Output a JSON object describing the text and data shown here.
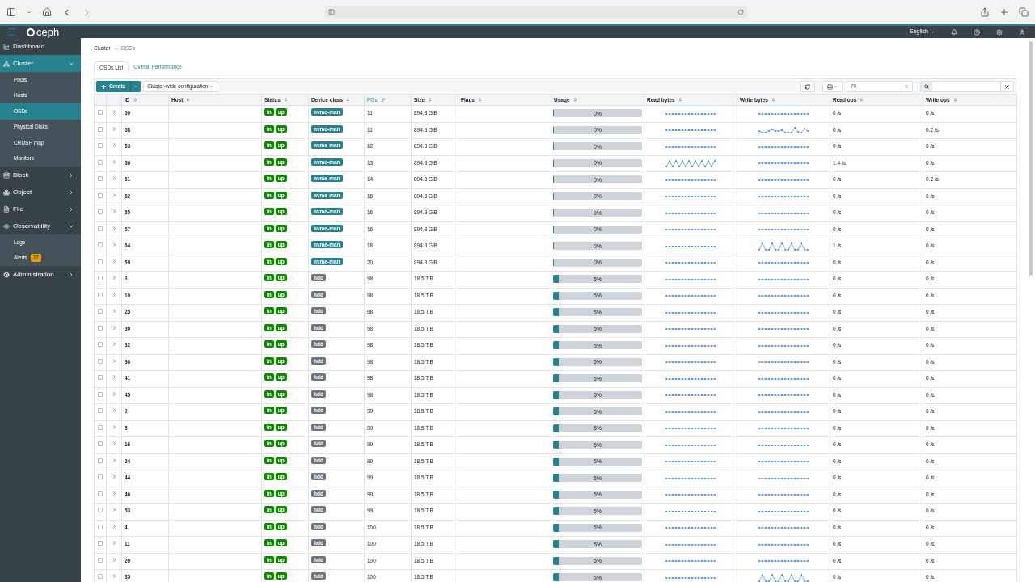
{
  "navbar": {
    "brand": "ceph",
    "language": "English"
  },
  "sidebar": [
    {
      "label": "Dashboard",
      "selected": false
    },
    {
      "label": "Cluster",
      "selected": true,
      "expanded": true,
      "children": [
        {
          "label": "Pools",
          "selected": false
        },
        {
          "label": "Hosts",
          "selected": false
        },
        {
          "label": "OSDs",
          "selected": true
        },
        {
          "label": "Physical Disks",
          "selected": false
        },
        {
          "label": "CRUSH map",
          "selected": false
        },
        {
          "label": "Monitors",
          "selected": false
        }
      ]
    },
    {
      "label": "Block",
      "selected": false,
      "expanded": false
    },
    {
      "label": "Object",
      "selected": false,
      "expanded": false
    },
    {
      "label": "File",
      "selected": false,
      "expanded": false
    },
    {
      "label": "Observability",
      "selected": false,
      "expanded": true,
      "children": [
        {
          "label": "Logs",
          "selected": false
        },
        {
          "label": "Alerts",
          "selected": false,
          "badge": "27"
        }
      ]
    },
    {
      "label": "Administration",
      "selected": false,
      "expanded": false
    }
  ],
  "breadcrumb": [
    "Cluster",
    "OSDs"
  ],
  "tabs": [
    {
      "label": "OSDs List",
      "selected": true
    },
    {
      "label": "Overall Performance",
      "selected": false
    }
  ],
  "toolbar": {
    "create": "Create",
    "config": "Cluster-wide configuration",
    "page_size": "70"
  },
  "table": {
    "columns": [
      {
        "label": "ID",
        "sorted": false
      },
      {
        "label": "Host",
        "sorted": false
      },
      {
        "label": "Status",
        "sorted": false
      },
      {
        "label": "Device class",
        "sorted": false
      },
      {
        "label": "PGs",
        "sorted": true
      },
      {
        "label": "Size",
        "sorted": false
      },
      {
        "label": "Flags",
        "sorted": false
      },
      {
        "label": "Usage",
        "sorted": false
      },
      {
        "label": "Read bytes",
        "sorted": false
      },
      {
        "label": "Write bytes",
        "sorted": false
      },
      {
        "label": "Read ops",
        "sorted": false
      },
      {
        "label": "Write ops",
        "sorted": false
      }
    ],
    "rows": [
      {
        "id": "60",
        "status": [
          "in",
          "up"
        ],
        "device_class": "nvme-man",
        "kind": "nvme",
        "pgs": "11",
        "size": "894.3 GiB",
        "usage": "0%",
        "level": 0,
        "read_bytes": {
          "kind": "flat"
        },
        "write_bytes": {
          "kind": "flat"
        },
        "read_ops": "0 /s",
        "write_ops": "0 /s",
        "checked": false
      },
      {
        "id": "68",
        "status": [
          "in",
          "up"
        ],
        "device_class": "nvme-man",
        "kind": "nvme",
        "pgs": "11",
        "size": "894.3 GiB",
        "usage": "0%",
        "level": 0,
        "read_bytes": {
          "kind": "flat"
        },
        "write_bytes": {
          "kind": "wavy"
        },
        "read_ops": "0 /s",
        "write_ops": "0.2 /s",
        "checked": false
      },
      {
        "id": "63",
        "status": [
          "in",
          "up"
        ],
        "device_class": "nvme-man",
        "kind": "nvme",
        "pgs": "12",
        "size": "894.3 GiB",
        "usage": "0%",
        "level": 0,
        "read_bytes": {
          "kind": "flat"
        },
        "write_bytes": {
          "kind": "flat"
        },
        "read_ops": "0 /s",
        "write_ops": "0 /s",
        "checked": false
      },
      {
        "id": "66",
        "status": [
          "in",
          "up"
        ],
        "device_class": "nvme-man",
        "kind": "nvme",
        "pgs": "13",
        "size": "894.3 GiB",
        "usage": "0%",
        "level": 0,
        "read_bytes": {
          "kind": "zigzag"
        },
        "write_bytes": {
          "kind": "flat"
        },
        "read_ops": "1.4 /s",
        "write_ops": "0 /s",
        "checked": false
      },
      {
        "id": "61",
        "status": [
          "in",
          "up"
        ],
        "device_class": "nvme-man",
        "kind": "nvme",
        "pgs": "14",
        "size": "894.3 GiB",
        "usage": "0%",
        "level": 0,
        "read_bytes": {
          "kind": "flat"
        },
        "write_bytes": {
          "kind": "flat"
        },
        "read_ops": "0 /s",
        "write_ops": "0.2 /s",
        "checked": false
      },
      {
        "id": "62",
        "status": [
          "in",
          "up"
        ],
        "device_class": "nvme-man",
        "kind": "nvme",
        "pgs": "16",
        "size": "894.3 GiB",
        "usage": "0%",
        "level": 0,
        "read_bytes": {
          "kind": "flat"
        },
        "write_bytes": {
          "kind": "flat"
        },
        "read_ops": "0 /s",
        "write_ops": "0 /s",
        "checked": false
      },
      {
        "id": "65",
        "status": [
          "in",
          "up"
        ],
        "device_class": "nvme-man",
        "kind": "nvme",
        "pgs": "16",
        "size": "894.3 GiB",
        "usage": "0%",
        "level": 0,
        "read_bytes": {
          "kind": "flat"
        },
        "write_bytes": {
          "kind": "flat"
        },
        "read_ops": "0 /s",
        "write_ops": "0 /s",
        "checked": false
      },
      {
        "id": "67",
        "status": [
          "in",
          "up"
        ],
        "device_class": "nvme-man",
        "kind": "nvme",
        "pgs": "16",
        "size": "894.3 GiB",
        "usage": "0%",
        "level": 0,
        "read_bytes": {
          "kind": "flat"
        },
        "write_bytes": {
          "kind": "flat"
        },
        "read_ops": "0 /s",
        "write_ops": "0 /s",
        "checked": false
      },
      {
        "id": "64",
        "status": [
          "in",
          "up"
        ],
        "device_class": "nvme-man",
        "kind": "nvme",
        "pgs": "18",
        "size": "894.3 GiB",
        "usage": "0%",
        "level": 0,
        "read_bytes": {
          "kind": "flat"
        },
        "write_bytes": {
          "kind": "spiky"
        },
        "read_ops": "1 /s",
        "write_ops": "0 /s",
        "checked": false
      },
      {
        "id": "69",
        "status": [
          "in",
          "up"
        ],
        "device_class": "nvme-man",
        "kind": "nvme",
        "pgs": "20",
        "size": "894.3 GiB",
        "usage": "0%",
        "level": 0,
        "read_bytes": {
          "kind": "flat"
        },
        "write_bytes": {
          "kind": "flat"
        },
        "read_ops": "0 /s",
        "write_ops": "0 /s",
        "checked": false
      },
      {
        "id": "3",
        "status": [
          "in",
          "up"
        ],
        "device_class": "hdd",
        "kind": "hdd",
        "pgs": "98",
        "size": "18.5 TiB",
        "usage": "5%",
        "level": 0.05,
        "read_bytes": {
          "kind": "flat"
        },
        "write_bytes": {
          "kind": "flat"
        },
        "read_ops": "0 /s",
        "write_ops": "0 /s",
        "checked": false
      },
      {
        "id": "10",
        "status": [
          "in",
          "up"
        ],
        "device_class": "hdd",
        "kind": "hdd",
        "pgs": "98",
        "size": "18.5 TiB",
        "usage": "5%",
        "level": 0.05,
        "read_bytes": {
          "kind": "flat"
        },
        "write_bytes": {
          "kind": "flat"
        },
        "read_ops": "0 /s",
        "write_ops": "0 /s",
        "checked": false
      },
      {
        "id": "25",
        "status": [
          "in",
          "up"
        ],
        "device_class": "hdd",
        "kind": "hdd",
        "pgs": "98",
        "size": "18.5 TiB",
        "usage": "5%",
        "level": 0.05,
        "read_bytes": {
          "kind": "flat"
        },
        "write_bytes": {
          "kind": "flat"
        },
        "read_ops": "0 /s",
        "write_ops": "0 /s",
        "checked": false
      },
      {
        "id": "30",
        "status": [
          "in",
          "up"
        ],
        "device_class": "hdd",
        "kind": "hdd",
        "pgs": "98",
        "size": "18.5 TiB",
        "usage": "5%",
        "level": 0.05,
        "read_bytes": {
          "kind": "flat"
        },
        "write_bytes": {
          "kind": "flat"
        },
        "read_ops": "0 /s",
        "write_ops": "0 /s",
        "checked": false
      },
      {
        "id": "32",
        "status": [
          "in",
          "up"
        ],
        "device_class": "hdd",
        "kind": "hdd",
        "pgs": "98",
        "size": "18.5 TiB",
        "usage": "5%",
        "level": 0.05,
        "read_bytes": {
          "kind": "flat"
        },
        "write_bytes": {
          "kind": "flat"
        },
        "read_ops": "0 /s",
        "write_ops": "0 /s",
        "checked": false
      },
      {
        "id": "36",
        "status": [
          "in",
          "up"
        ],
        "device_class": "hdd",
        "kind": "hdd",
        "pgs": "98",
        "size": "18.5 TiB",
        "usage": "5%",
        "level": 0.05,
        "read_bytes": {
          "kind": "flat"
        },
        "write_bytes": {
          "kind": "flat"
        },
        "read_ops": "0 /s",
        "write_ops": "0 /s",
        "checked": false
      },
      {
        "id": "41",
        "status": [
          "in",
          "up"
        ],
        "device_class": "hdd",
        "kind": "hdd",
        "pgs": "98",
        "size": "18.5 TiB",
        "usage": "5%",
        "level": 0.05,
        "read_bytes": {
          "kind": "flat"
        },
        "write_bytes": {
          "kind": "flat"
        },
        "read_ops": "0 /s",
        "write_ops": "0 /s",
        "checked": false
      },
      {
        "id": "45",
        "status": [
          "in",
          "up"
        ],
        "device_class": "hdd",
        "kind": "hdd",
        "pgs": "98",
        "size": "18.5 TiB",
        "usage": "5%",
        "level": 0.05,
        "read_bytes": {
          "kind": "flat"
        },
        "write_bytes": {
          "kind": "flat"
        },
        "read_ops": "0 /s",
        "write_ops": "0 /s",
        "checked": false
      },
      {
        "id": "0",
        "status": [
          "in",
          "up"
        ],
        "device_class": "hdd",
        "kind": "hdd",
        "pgs": "99",
        "size": "18.5 TiB",
        "usage": "5%",
        "level": 0.05,
        "read_bytes": {
          "kind": "flat"
        },
        "write_bytes": {
          "kind": "flat"
        },
        "read_ops": "0 /s",
        "write_ops": "0 /s",
        "checked": false
      },
      {
        "id": "5",
        "status": [
          "in",
          "up"
        ],
        "device_class": "hdd",
        "kind": "hdd",
        "pgs": "99",
        "size": "18.5 TiB",
        "usage": "5%",
        "level": 0.05,
        "read_bytes": {
          "kind": "flat"
        },
        "write_bytes": {
          "kind": "flat"
        },
        "read_ops": "0 /s",
        "write_ops": "0 /s",
        "checked": false
      },
      {
        "id": "16",
        "status": [
          "in",
          "up"
        ],
        "device_class": "hdd",
        "kind": "hdd",
        "pgs": "99",
        "size": "18.5 TiB",
        "usage": "5%",
        "level": 0.05,
        "read_bytes": {
          "kind": "flat"
        },
        "write_bytes": {
          "kind": "flat"
        },
        "read_ops": "0 /s",
        "write_ops": "0 /s",
        "checked": false
      },
      {
        "id": "24",
        "status": [
          "in",
          "up"
        ],
        "device_class": "hdd",
        "kind": "hdd",
        "pgs": "99",
        "size": "18.5 TiB",
        "usage": "5%",
        "level": 0.05,
        "read_bytes": {
          "kind": "flat"
        },
        "write_bytes": {
          "kind": "flat"
        },
        "read_ops": "0 /s",
        "write_ops": "0 /s",
        "checked": false
      },
      {
        "id": "44",
        "status": [
          "in",
          "up"
        ],
        "device_class": "hdd",
        "kind": "hdd",
        "pgs": "99",
        "size": "18.5 TiB",
        "usage": "5%",
        "level": 0.05,
        "read_bytes": {
          "kind": "flat"
        },
        "write_bytes": {
          "kind": "flat"
        },
        "read_ops": "0 /s",
        "write_ops": "0 /s",
        "checked": false
      },
      {
        "id": "46",
        "status": [
          "in",
          "up"
        ],
        "device_class": "hdd",
        "kind": "hdd",
        "pgs": "99",
        "size": "18.5 TiB",
        "usage": "5%",
        "level": 0.05,
        "read_bytes": {
          "kind": "flat"
        },
        "write_bytes": {
          "kind": "flat"
        },
        "read_ops": "0 /s",
        "write_ops": "0 /s",
        "checked": false
      },
      {
        "id": "53",
        "status": [
          "in",
          "up"
        ],
        "device_class": "hdd",
        "kind": "hdd",
        "pgs": "99",
        "size": "18.5 TiB",
        "usage": "5%",
        "level": 0.05,
        "read_bytes": {
          "kind": "flat"
        },
        "write_bytes": {
          "kind": "flat"
        },
        "read_ops": "0 /s",
        "write_ops": "0 /s",
        "checked": false
      },
      {
        "id": "4",
        "status": [
          "in",
          "up"
        ],
        "device_class": "hdd",
        "kind": "hdd",
        "pgs": "100",
        "size": "18.5 TiB",
        "usage": "5%",
        "level": 0.05,
        "read_bytes": {
          "kind": "flat"
        },
        "write_bytes": {
          "kind": "flat"
        },
        "read_ops": "0 /s",
        "write_ops": "0 /s",
        "checked": false
      },
      {
        "id": "11",
        "status": [
          "in",
          "up"
        ],
        "device_class": "hdd",
        "kind": "hdd",
        "pgs": "100",
        "size": "18.5 TiB",
        "usage": "5%",
        "level": 0.05,
        "read_bytes": {
          "kind": "flat"
        },
        "write_bytes": {
          "kind": "flat"
        },
        "read_ops": "0 /s",
        "write_ops": "0 /s",
        "checked": false
      },
      {
        "id": "20",
        "status": [
          "in",
          "up"
        ],
        "device_class": "hdd",
        "kind": "hdd",
        "pgs": "100",
        "size": "18.5 TiB",
        "usage": "5%",
        "level": 0.05,
        "read_bytes": {
          "kind": "flat"
        },
        "write_bytes": {
          "kind": "flat"
        },
        "read_ops": "0 /s",
        "write_ops": "0 /s",
        "checked": false
      },
      {
        "id": "35",
        "status": [
          "in",
          "up"
        ],
        "device_class": "hdd",
        "kind": "hdd",
        "pgs": "100",
        "size": "18.5 TiB",
        "usage": "5%",
        "level": 0.05,
        "read_bytes": {
          "kind": "flat"
        },
        "write_bytes": {
          "kind": "spiky"
        },
        "read_ops": "0 /s",
        "write_ops": "0 /s",
        "checked": false
      }
    ]
  }
}
